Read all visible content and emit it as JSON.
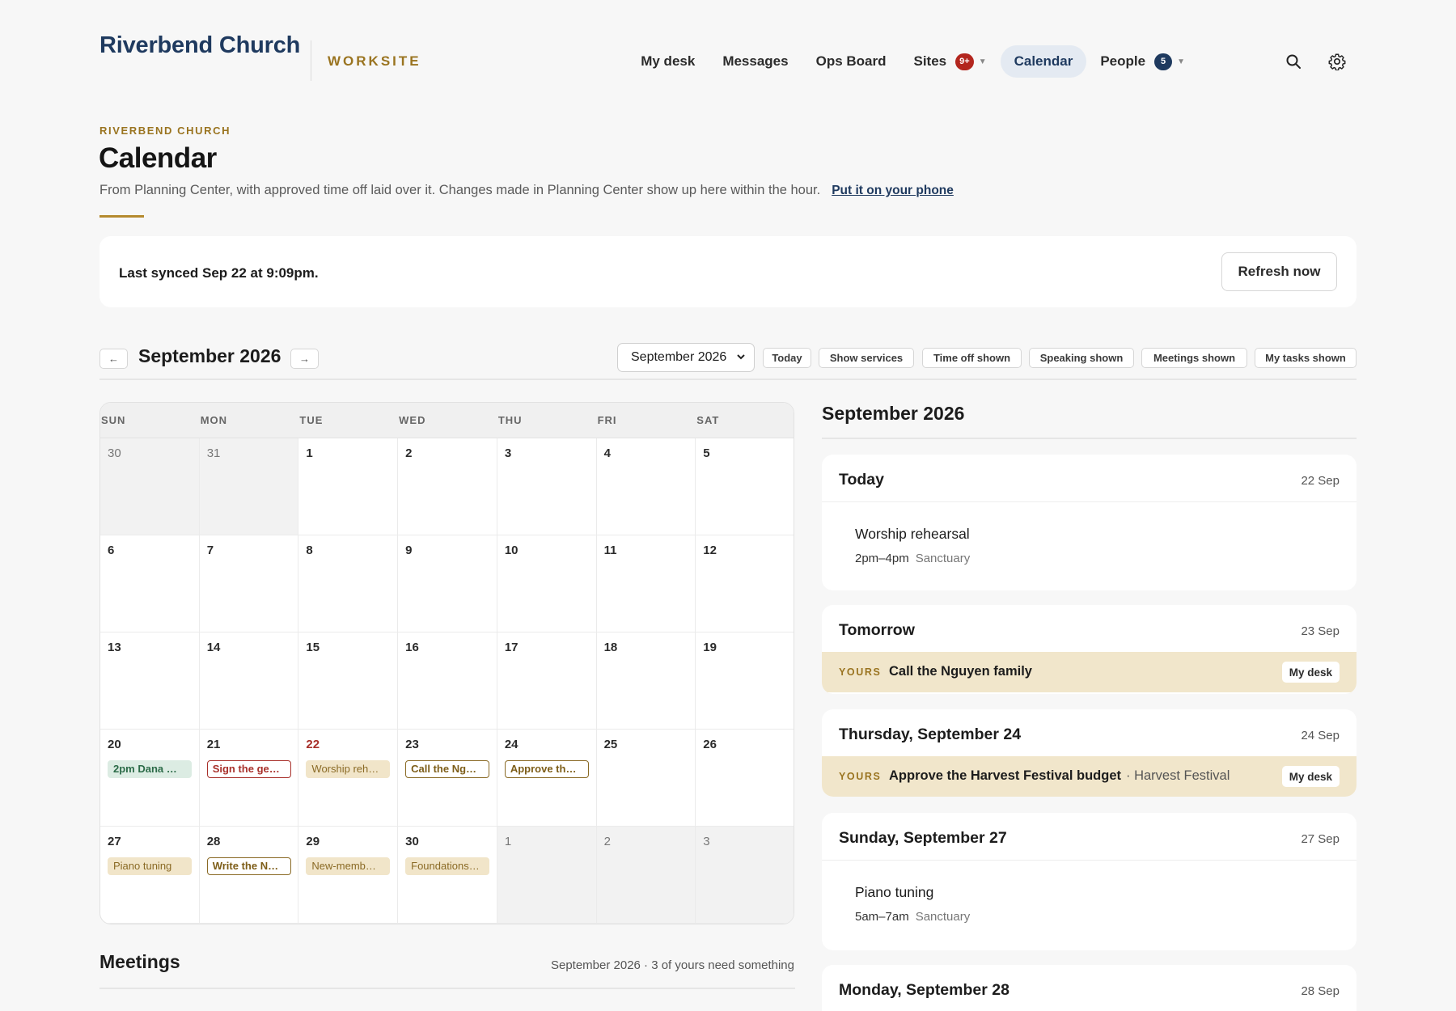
{
  "header": {
    "brand": "Riverbend Church",
    "brand_sub": "WORKSITE",
    "nav": [
      {
        "label": "My desk"
      },
      {
        "label": "Messages"
      },
      {
        "label": "Ops Board"
      },
      {
        "label": "Sites",
        "badge": "9+"
      },
      {
        "label": "Calendar",
        "active": true
      },
      {
        "label": "People",
        "badge": "5"
      }
    ],
    "icons": [
      "search-icon",
      "gear-icon"
    ]
  },
  "page": {
    "eyebrow": "RIVERBEND CHURCH",
    "title": "Calendar",
    "description": "From Planning Center, with approved time off laid over it. Changes made in Planning Center show up here within the hour.",
    "phone_link": "Put it on your phone"
  },
  "sync": {
    "text": "Last synced Sep 22 at 9:09pm.",
    "refresh_label": "Refresh now"
  },
  "toolbar": {
    "prev": "←",
    "next": "→",
    "month_title": "September 2026",
    "select_value": "September 2026",
    "chips": [
      "Today",
      "Show services",
      "Time off shown",
      "Speaking shown",
      "Meetings shown",
      "My tasks shown"
    ]
  },
  "calendar": {
    "weekdays": [
      "SUN",
      "MON",
      "TUE",
      "WED",
      "THU",
      "FRI",
      "SAT"
    ],
    "weeks": [
      [
        {
          "d": "30",
          "m": true
        },
        {
          "d": "31",
          "m": true
        },
        {
          "d": "1"
        },
        {
          "d": "2"
        },
        {
          "d": "3"
        },
        {
          "d": "4"
        },
        {
          "d": "5"
        }
      ],
      [
        {
          "d": "6"
        },
        {
          "d": "7"
        },
        {
          "d": "8"
        },
        {
          "d": "9"
        },
        {
          "d": "10"
        },
        {
          "d": "11"
        },
        {
          "d": "12"
        }
      ],
      [
        {
          "d": "13"
        },
        {
          "d": "14"
        },
        {
          "d": "15"
        },
        {
          "d": "16"
        },
        {
          "d": "17"
        },
        {
          "d": "18"
        },
        {
          "d": "19"
        }
      ],
      [
        {
          "d": "20",
          "ev": "2pm Dana …",
          "style": "green"
        },
        {
          "d": "21",
          "ev": "Sign the ge…",
          "style": "red-outline"
        },
        {
          "d": "22",
          "today": true,
          "ev": "Worship reh…",
          "style": "tan"
        },
        {
          "d": "23",
          "ev": "Call the Ng…",
          "style": "gold-outline"
        },
        {
          "d": "24",
          "ev": "Approve th…",
          "style": "gold-outline"
        },
        {
          "d": "25"
        },
        {
          "d": "26"
        }
      ],
      [
        {
          "d": "27",
          "ev": "Piano tuning",
          "style": "tan"
        },
        {
          "d": "28",
          "ev": "Write the N…",
          "style": "gold-outline"
        },
        {
          "d": "29",
          "ev": "New-memb…",
          "style": "tan"
        },
        {
          "d": "30",
          "ev": "Foundations…",
          "style": "tan"
        },
        {
          "d": "1",
          "m": true
        },
        {
          "d": "2",
          "m": true
        },
        {
          "d": "3",
          "m": true
        }
      ]
    ]
  },
  "meetings": {
    "title": "Meetings",
    "summary": "September 2026 · 3 of yours need something"
  },
  "agenda": {
    "title": "September 2026",
    "days": [
      {
        "day": "Today",
        "date": "22 Sep",
        "event": {
          "name": "Worship rehearsal",
          "time": "2pm–4pm",
          "location": "Sanctuary"
        }
      },
      {
        "day": "Tomorrow",
        "date": "23 Sep",
        "task": {
          "tag": "YOURS",
          "text": "Call the Nguyen family",
          "context": "",
          "button": "My desk"
        }
      },
      {
        "day": "Thursday, September 24",
        "date": "24 Sep",
        "task": {
          "tag": "YOURS",
          "text": "Approve the Harvest Festival budget",
          "context": "· Harvest Festival",
          "button": "My desk"
        }
      },
      {
        "day": "Sunday, September 27",
        "date": "27 Sep",
        "event": {
          "name": "Piano tuning",
          "time": "5am–7am",
          "location": "Sanctuary"
        }
      },
      {
        "day": "Monday, September 28",
        "date": "28 Sep"
      }
    ]
  },
  "colors": {
    "brand": "#1f3a5f",
    "accent_gold": "#9a7420",
    "alert_red": "#b3261e"
  }
}
